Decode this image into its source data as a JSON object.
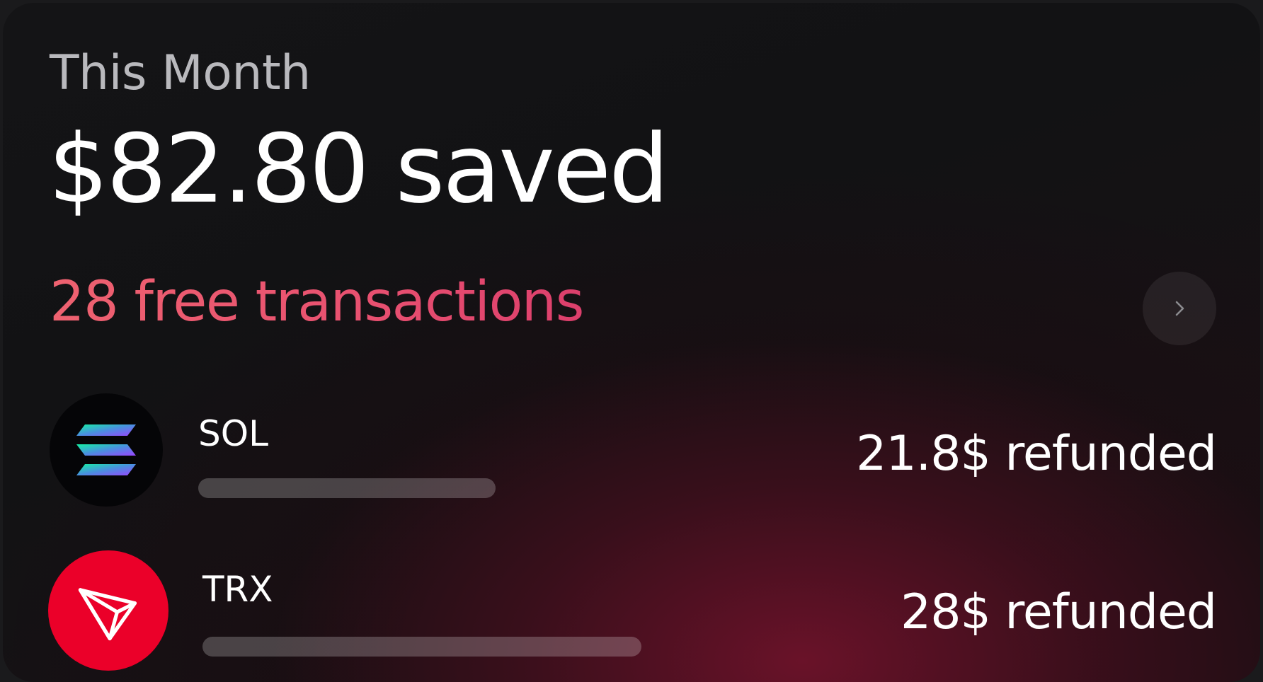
{
  "summary": {
    "period": "This Month",
    "headline": "$82.80 saved",
    "subtitle": "28 free transactions",
    "accent_color": "#e85070"
  },
  "action": {
    "icon": "chevron-right-icon"
  },
  "coins": [
    {
      "symbol": "SOL",
      "refund_text": "21.8$ refunded",
      "logo_icon": "solana-icon",
      "logo_bg": "#050507"
    },
    {
      "symbol": "TRX",
      "refund_text": "28$ refunded",
      "logo_icon": "tron-icon",
      "logo_bg": "#eb0029"
    }
  ]
}
